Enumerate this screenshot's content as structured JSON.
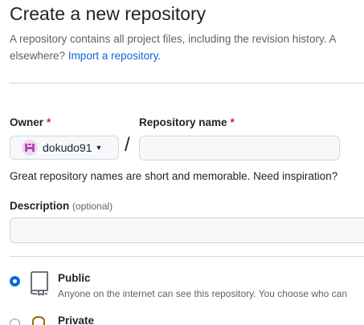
{
  "header": {
    "title": "Create a new repository",
    "intro_line1": "A repository contains all project files, including the revision history. A",
    "intro_line2_prefix": "elsewhere?",
    "import_link": "Import a repository."
  },
  "owner": {
    "label": "Owner",
    "required_mark": "*",
    "selected": "dokudo91"
  },
  "separator": "/",
  "repo_name": {
    "label": "Repository name",
    "required_mark": "*",
    "value": "",
    "hint": "Great repository names are short and memorable. Need inspiration?"
  },
  "description": {
    "label": "Description",
    "optional_label": "(optional)",
    "value": ""
  },
  "visibility": {
    "selected": "Public",
    "options": [
      {
        "title": "Public",
        "description": "Anyone on the internet can see this repository. You choose who can",
        "icon": "repo-icon"
      },
      {
        "title": "Private",
        "description": "",
        "icon": "lock-icon"
      }
    ]
  },
  "colors": {
    "link": "#0969da",
    "required": "#d1242f",
    "radio_checked": "#0969da",
    "muted_text": "#59636e"
  }
}
